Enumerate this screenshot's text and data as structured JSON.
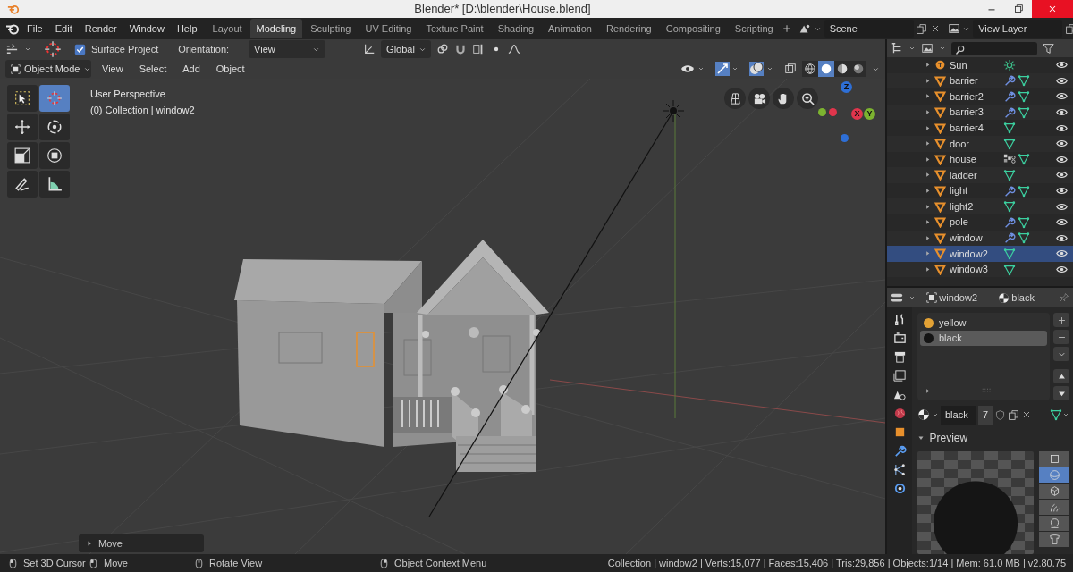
{
  "window": {
    "title": "Blender* [D:\\blender\\House.blend]"
  },
  "menu": [
    "File",
    "Edit",
    "Render",
    "Window",
    "Help"
  ],
  "workspaces": [
    {
      "label": "Layout",
      "selected": false
    },
    {
      "label": "Modeling",
      "selected": true
    },
    {
      "label": "Sculpting",
      "selected": false
    },
    {
      "label": "UV Editing",
      "selected": false
    },
    {
      "label": "Texture Paint",
      "selected": false
    },
    {
      "label": "Shading",
      "selected": false
    },
    {
      "label": "Animation",
      "selected": false
    },
    {
      "label": "Rendering",
      "selected": false
    },
    {
      "label": "Compositing",
      "selected": false
    },
    {
      "label": "Scripting",
      "selected": false
    }
  ],
  "scene": {
    "value": "Scene"
  },
  "view_layer": {
    "value": "View Layer"
  },
  "tool_settings": {
    "surface_project": {
      "label": "Surface Project",
      "checked": true
    },
    "orientation_label": "Orientation:",
    "orientation_value": "View",
    "transform_orientation": "Global"
  },
  "viewport_header": {
    "mode": "Object Mode",
    "menus": [
      "View",
      "Select",
      "Add",
      "Object"
    ],
    "shading": [
      {
        "kind": "wireframe",
        "selected": false
      },
      {
        "kind": "solid",
        "selected": true
      },
      {
        "kind": "material",
        "selected": false
      },
      {
        "kind": "rendered",
        "selected": false
      }
    ]
  },
  "tools": [
    {
      "kind": "select",
      "selected": false
    },
    {
      "kind": "cursor",
      "selected": true
    },
    {
      "kind": "move",
      "selected": false
    },
    {
      "kind": "rotate",
      "selected": false
    },
    {
      "kind": "scale",
      "selected": false
    },
    {
      "kind": "transform",
      "selected": false
    },
    {
      "kind": "annotate",
      "selected": false
    },
    {
      "kind": "measure",
      "selected": false
    }
  ],
  "viewport": {
    "perspective": "User Perspective",
    "collection": "(0) Collection | window2",
    "last_operator": "Move"
  },
  "axis_gizmo": [
    {
      "label": "Z",
      "color": "#2e6fd6"
    },
    {
      "label": "X",
      "color": "#e0354c"
    },
    {
      "label": "Y",
      "color": "#7cb330"
    }
  ],
  "outliner": {
    "items": [
      {
        "name": "Sun",
        "kind": "light",
        "data": [
          {
            "kind": "sun"
          }
        ],
        "selected": false
      },
      {
        "name": "barrier",
        "kind": "mesh",
        "data": [
          {
            "kind": "modifier"
          },
          {
            "kind": "mesh"
          }
        ],
        "selected": false
      },
      {
        "name": "barrier2",
        "kind": "mesh",
        "data": [
          {
            "kind": "modifier"
          },
          {
            "kind": "mesh"
          }
        ],
        "selected": false
      },
      {
        "name": "barrier3",
        "kind": "mesh",
        "data": [
          {
            "kind": "modifier"
          },
          {
            "kind": "mesh"
          }
        ],
        "selected": false
      },
      {
        "name": "barrier4",
        "kind": "mesh",
        "data": [
          {
            "kind": "mesh"
          }
        ],
        "selected": false
      },
      {
        "name": "door",
        "kind": "mesh",
        "data": [
          {
            "kind": "mesh"
          }
        ],
        "selected": false
      },
      {
        "name": "house",
        "kind": "mesh",
        "data": [
          {
            "kind": "groups"
          },
          {
            "kind": "mesh"
          }
        ],
        "selected": false
      },
      {
        "name": "ladder",
        "kind": "mesh",
        "data": [
          {
            "kind": "mesh"
          }
        ],
        "selected": false
      },
      {
        "name": "light",
        "kind": "mesh",
        "data": [
          {
            "kind": "modifier"
          },
          {
            "kind": "mesh"
          }
        ],
        "selected": false
      },
      {
        "name": "light2",
        "kind": "mesh",
        "data": [
          {
            "kind": "mesh"
          }
        ],
        "selected": false
      },
      {
        "name": "pole",
        "kind": "mesh",
        "data": [
          {
            "kind": "modifier"
          },
          {
            "kind": "mesh"
          }
        ],
        "selected": false
      },
      {
        "name": "window",
        "kind": "mesh",
        "data": [
          {
            "kind": "modifier"
          },
          {
            "kind": "mesh"
          }
        ],
        "selected": false
      },
      {
        "name": "window2",
        "kind": "mesh",
        "data": [
          {
            "kind": "mesh"
          }
        ],
        "selected": true
      },
      {
        "name": "window3",
        "kind": "mesh",
        "data": [
          {
            "kind": "mesh"
          }
        ],
        "selected": false
      }
    ]
  },
  "properties": {
    "object": "window2",
    "material": "black",
    "slots": [
      {
        "name": "yellow",
        "color": "#e3a235",
        "selected": false
      },
      {
        "name": "black",
        "color": "#141414",
        "selected": true
      }
    ],
    "material_field": "black",
    "users": "7",
    "preview_title": "Preview",
    "preview_shapes": [
      {
        "kind": "flat",
        "selected": false
      },
      {
        "kind": "sphere",
        "selected": true
      },
      {
        "kind": "cube",
        "selected": false
      },
      {
        "kind": "hair",
        "selected": false
      },
      {
        "kind": "monkey",
        "selected": false
      },
      {
        "kind": "cloth",
        "selected": false
      }
    ]
  },
  "status_bar": {
    "hints": [
      {
        "kind": "left",
        "label": "Set 3D Cursor"
      },
      {
        "kind": "drag",
        "label": "Move"
      },
      {
        "kind": "middle",
        "label": "Rotate View"
      },
      {
        "kind": "right",
        "label": "Object Context Menu"
      }
    ],
    "stats": "Collection | window2 | Verts:15,077 | Faces:15,406 | Tris:29,856 | Objects:1/14 | Mem: 61.0 MB | v2.80.75"
  }
}
